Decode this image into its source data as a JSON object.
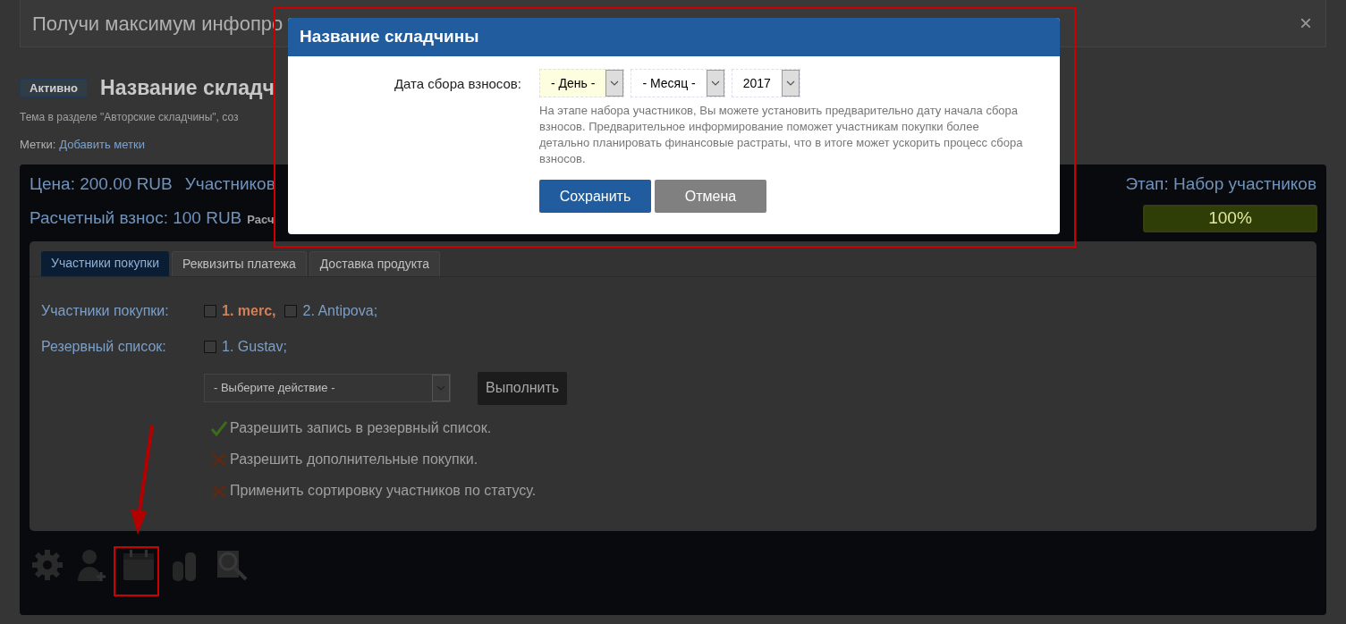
{
  "banner": {
    "text": "Получи максимум инфопро",
    "close": "×"
  },
  "header": {
    "status": "Активно",
    "title": "Название складч",
    "subtitle": "Тема в разделе \"Авторские складчины\", соз",
    "tags_label": "Метки:",
    "tags_link": "Добавить метки"
  },
  "panel": {
    "price": "Цена: 200.00 RUB",
    "participants": "Участников",
    "stage": "Этап: Набор участников",
    "fee": "Расчетный взнос: 100 RUB",
    "fee_extra": "Расч",
    "progress": {
      "level": 1,
      "reading": "100%"
    }
  },
  "tabs": [
    {
      "label": "Участники покупки",
      "selected": true
    },
    {
      "label": "Реквизиты платежа",
      "selected": false
    },
    {
      "label": "Доставка продукта",
      "selected": false
    }
  ],
  "lists": [
    {
      "label": "Участники покупки:",
      "members": [
        {
          "name": "1. merc,",
          "checked": false,
          "highlighted": true
        },
        {
          "name": "2. Antipova;",
          "checked": false,
          "highlighted": false
        }
      ]
    },
    {
      "label": "Резервный список:",
      "members": [
        {
          "name": "1. Gustav;",
          "checked": false,
          "highlighted": false
        }
      ]
    }
  ],
  "action": {
    "placeholder": "- Выберите действие -",
    "button": "Выполнить"
  },
  "options": [
    {
      "text": "Разрешить запись в резервный список.",
      "enabled": true
    },
    {
      "text": "Разрешить дополнительные покупки.",
      "enabled": false
    },
    {
      "text": "Применить сортировку участников по статусу.",
      "enabled": false
    }
  ],
  "modal": {
    "title": "Название складчины",
    "label": "Дата сбора взносов:",
    "selects": [
      {
        "value": "- День -",
        "highlighted": true
      },
      {
        "value": "- Месяц -",
        "highlighted": false
      },
      {
        "value": "2017",
        "highlighted": false
      }
    ],
    "hint": "На этапе набора участников, Вы можете установить предварительно дату начала сбора взносов. Предварительное информирование поможет участникам покупки более детально планировать финансовые растраты, что в итоге может ускорить процесс сбора взносов.",
    "buttons": [
      {
        "label": "Сохранить",
        "kind": "primary"
      },
      {
        "label": "Отмена",
        "kind": "secondary"
      }
    ]
  }
}
